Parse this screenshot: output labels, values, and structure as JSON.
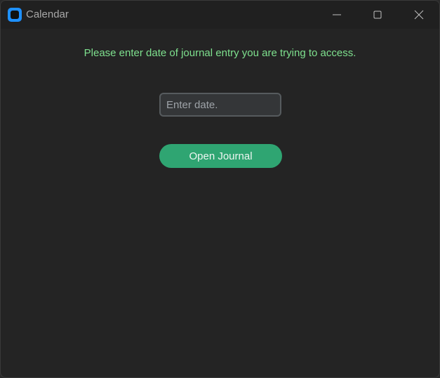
{
  "window": {
    "title": "Calendar",
    "app_icon": "app-icon",
    "controls": [
      "minimize-icon",
      "maximize-icon",
      "close-icon"
    ]
  },
  "main": {
    "prompt": "Please enter date of journal entry you are trying to access.",
    "date_input": {
      "value": "",
      "placeholder": "Enter date."
    },
    "open_button_label": "Open Journal"
  },
  "colors": {
    "prompt_text": "#7ee08e",
    "button_bg": "#2fa572",
    "window_bg": "#242424"
  }
}
